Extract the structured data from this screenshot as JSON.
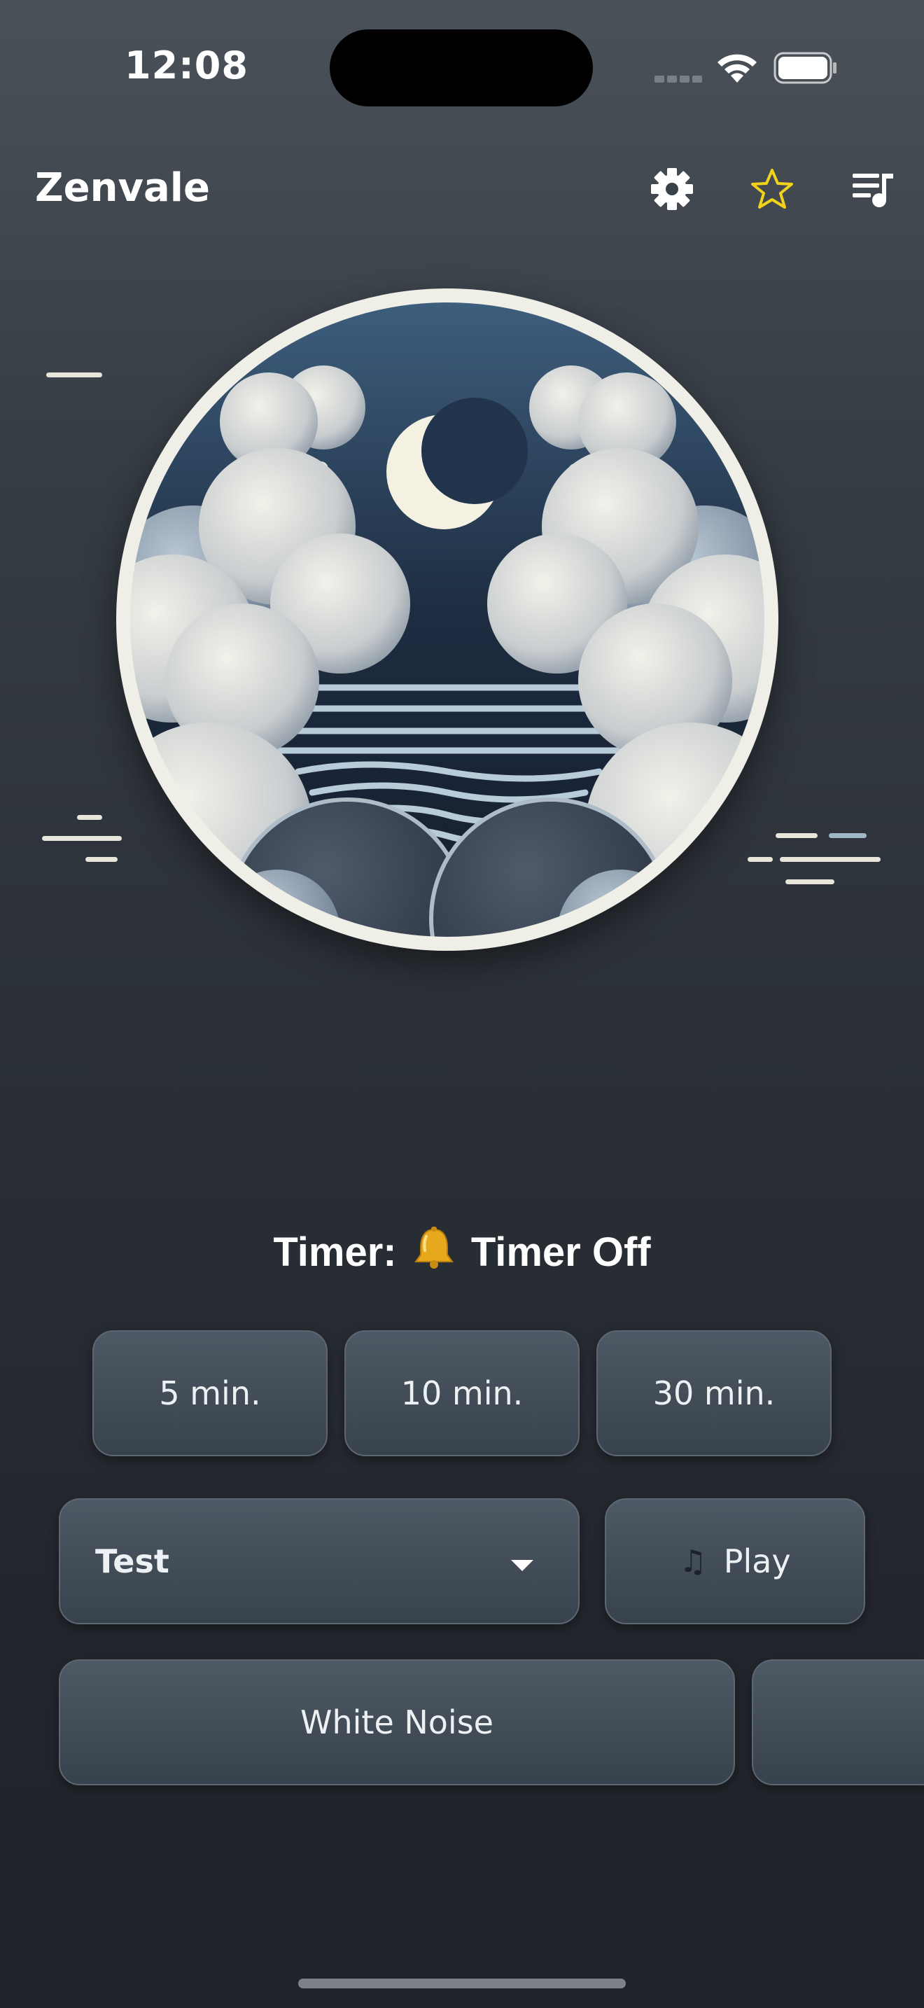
{
  "status_bar": {
    "time": "12:08"
  },
  "header": {
    "title": "Zenvale",
    "settings_icon": "gear-icon",
    "favorite_icon": "star-icon",
    "playlist_icon": "playlist-icon",
    "favorite_color": "#f2d21b"
  },
  "artwork": {
    "icon": "moon-clouds-sea-artwork"
  },
  "timer": {
    "prefix": "Timer:",
    "icon": "bell-icon",
    "status": "Timer Off",
    "options": [
      "5 min.",
      "10 min.",
      "30 min."
    ]
  },
  "sound_select": {
    "selected": "Test",
    "caret_icon": "caret-down-icon"
  },
  "play_button": {
    "icon": "♫",
    "label": "Play"
  },
  "sound_chips": [
    {
      "label": "White Noise"
    },
    {
      "label": ""
    }
  ]
}
